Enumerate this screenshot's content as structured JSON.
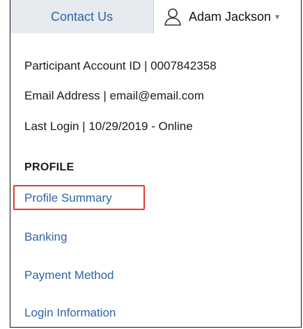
{
  "header": {
    "contact_label": "Contact Us",
    "user_name": "Adam Jackson",
    "user_icon": "user-icon",
    "caret_icon": "chevron-down-icon"
  },
  "account": {
    "participant_id": "Participant Account ID  |  0007842358",
    "email": "Email Address  |  email@email.com",
    "last_login": "Last Login |  10/29/2019 - Online"
  },
  "profile": {
    "heading": "PROFILE",
    "links": {
      "summary": "Profile Summary",
      "banking": "Banking",
      "payment_method": "Payment Method",
      "login_information": "Login Information"
    }
  },
  "colors": {
    "link": "#2d65a6",
    "highlight": "#e53935",
    "tab_bg": "#e7eaee"
  }
}
